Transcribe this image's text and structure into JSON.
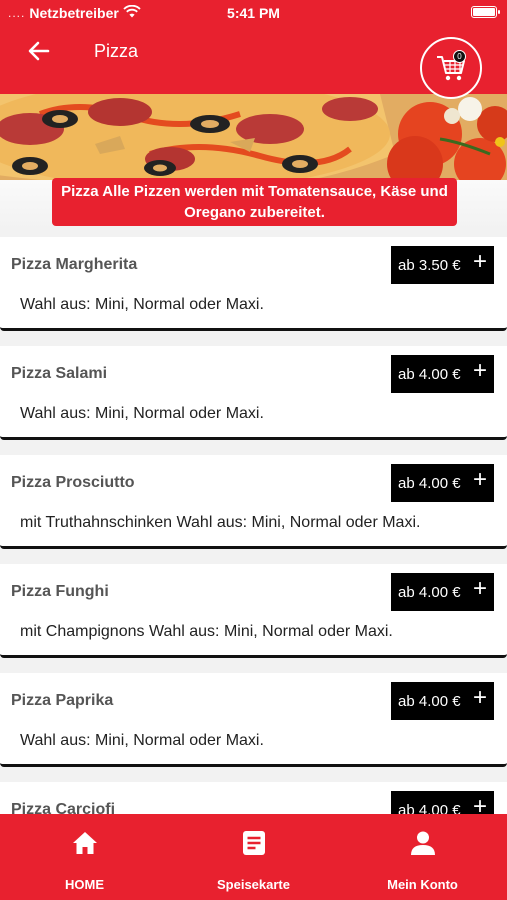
{
  "status_bar": {
    "dots": "....",
    "carrier": "Netzbetreiber",
    "time": "5:41 PM"
  },
  "header": {
    "title": "Pizza",
    "cart_count": "0"
  },
  "category_info": "Pizza Alle Pizzen werden mit Tomatensauce, Käse und Oregano zubereitet.",
  "menu_items": [
    {
      "name": "Pizza Margherita",
      "price": "ab 3.50 €",
      "add": "+",
      "description": "Wahl aus: Mini, Normal oder Maxi."
    },
    {
      "name": "Pizza Salami",
      "price": "ab 4.00 €",
      "add": "+",
      "description": "Wahl aus: Mini, Normal oder Maxi."
    },
    {
      "name": "Pizza Prosciutto",
      "price": "ab 4.00 €",
      "add": "+",
      "description": "mit Truthahnschinken Wahl aus: Mini, Normal oder Maxi."
    },
    {
      "name": "Pizza Funghi",
      "price": "ab 4.00 €",
      "add": "+",
      "description": "mit Champignons Wahl aus: Mini, Normal oder Maxi."
    },
    {
      "name": "Pizza Paprika",
      "price": "ab 4.00 €",
      "add": "+",
      "description": "Wahl aus: Mini, Normal oder Maxi."
    },
    {
      "name": "Pizza Carciofi",
      "price": "ab 4.00 €",
      "add": "+",
      "description": ""
    }
  ],
  "bottom_nav": [
    {
      "label": "HOME",
      "icon": "home-icon"
    },
    {
      "label": "Speisekarte",
      "icon": "menu-card-icon"
    },
    {
      "label": "Mein Konto",
      "icon": "user-icon"
    }
  ],
  "colors": {
    "brand_red": "#e8212f",
    "price_bg": "#000000"
  }
}
